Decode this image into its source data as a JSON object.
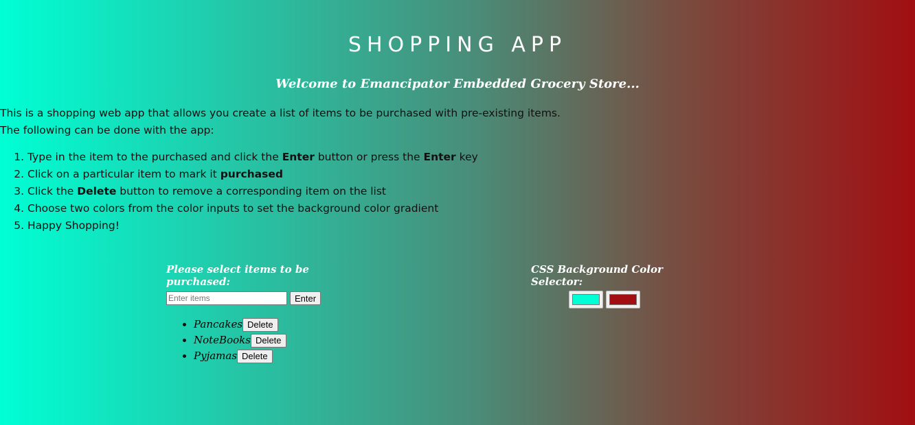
{
  "header": {
    "title": "SHOPPING APP",
    "subtitle": "Welcome to Emancipator Embedded Grocery Store..."
  },
  "intro": {
    "line1": "This is a shopping web app that allows you create a list of items to be purchased with pre-existing items.",
    "line2": "The following can be done with the app:"
  },
  "steps": [
    {
      "a": "Type in the item to the purchased and click the ",
      "b1": "Enter",
      "c": " button or press the ",
      "b2": "Enter",
      "d": " key"
    },
    {
      "a": "Click on a particular item to mark it ",
      "b1": "purchased"
    },
    {
      "a": "Click the ",
      "b1": "Delete",
      "c": " button to remove a corresponding item on the list"
    },
    {
      "a": "Choose two colors from the color inputs to set the background color gradient"
    },
    {
      "a": "Happy Shopping!"
    }
  ],
  "shopping": {
    "heading": "Please select items to be purchased:",
    "input_placeholder": "Enter items",
    "input_value": "",
    "enter_label": "Enter",
    "items": [
      {
        "name": "Pancakes",
        "delete_label": "Delete"
      },
      {
        "name": "NoteBooks",
        "delete_label": "Delete"
      },
      {
        "name": "Pyjamas",
        "delete_label": "Delete"
      }
    ]
  },
  "colors": {
    "heading": "CSS Background Color Selector:",
    "color1": "#00ffd5",
    "color2": "#a10f12"
  }
}
